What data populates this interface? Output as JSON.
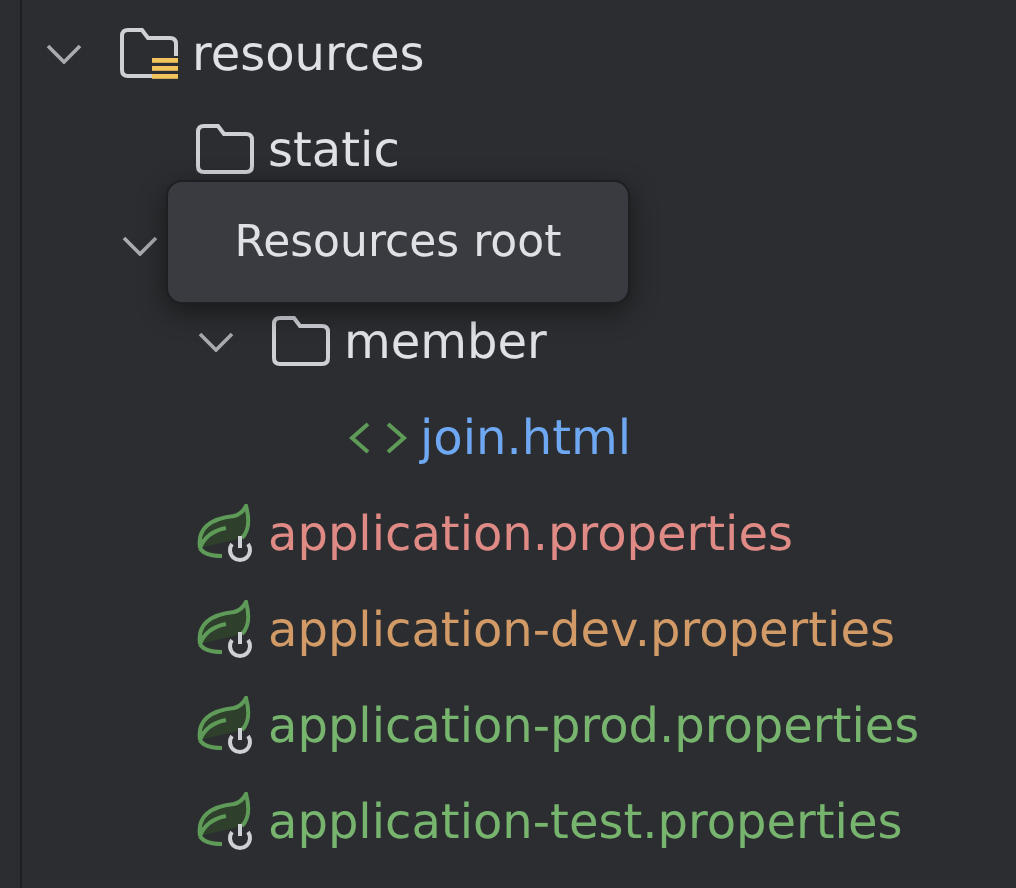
{
  "tree": [
    {
      "kind": "resources_folder",
      "name": "resources",
      "expanded": true,
      "children": [
        {
          "kind": "folder",
          "name": "static"
        },
        {
          "expanded": true,
          "children": [
            {
              "kind": "folder",
              "name": "member",
              "expanded": true,
              "children": [
                {
                  "kind": "html",
                  "name": "join.html",
                  "color": "#6fa8f2"
                }
              ]
            }
          ]
        },
        {
          "kind": "spring_properties",
          "name": "application.properties",
          "color": "#e08a86"
        },
        {
          "kind": "spring_properties",
          "name": "application-dev.properties",
          "color": "#d19a66"
        },
        {
          "kind": "spring_properties",
          "name": "application-prod.properties",
          "color": "#77b46e"
        },
        {
          "kind": "spring_properties",
          "name": "application-test.properties",
          "color": "#77b46e"
        }
      ]
    }
  ],
  "tooltip": {
    "text": "Resources root"
  }
}
